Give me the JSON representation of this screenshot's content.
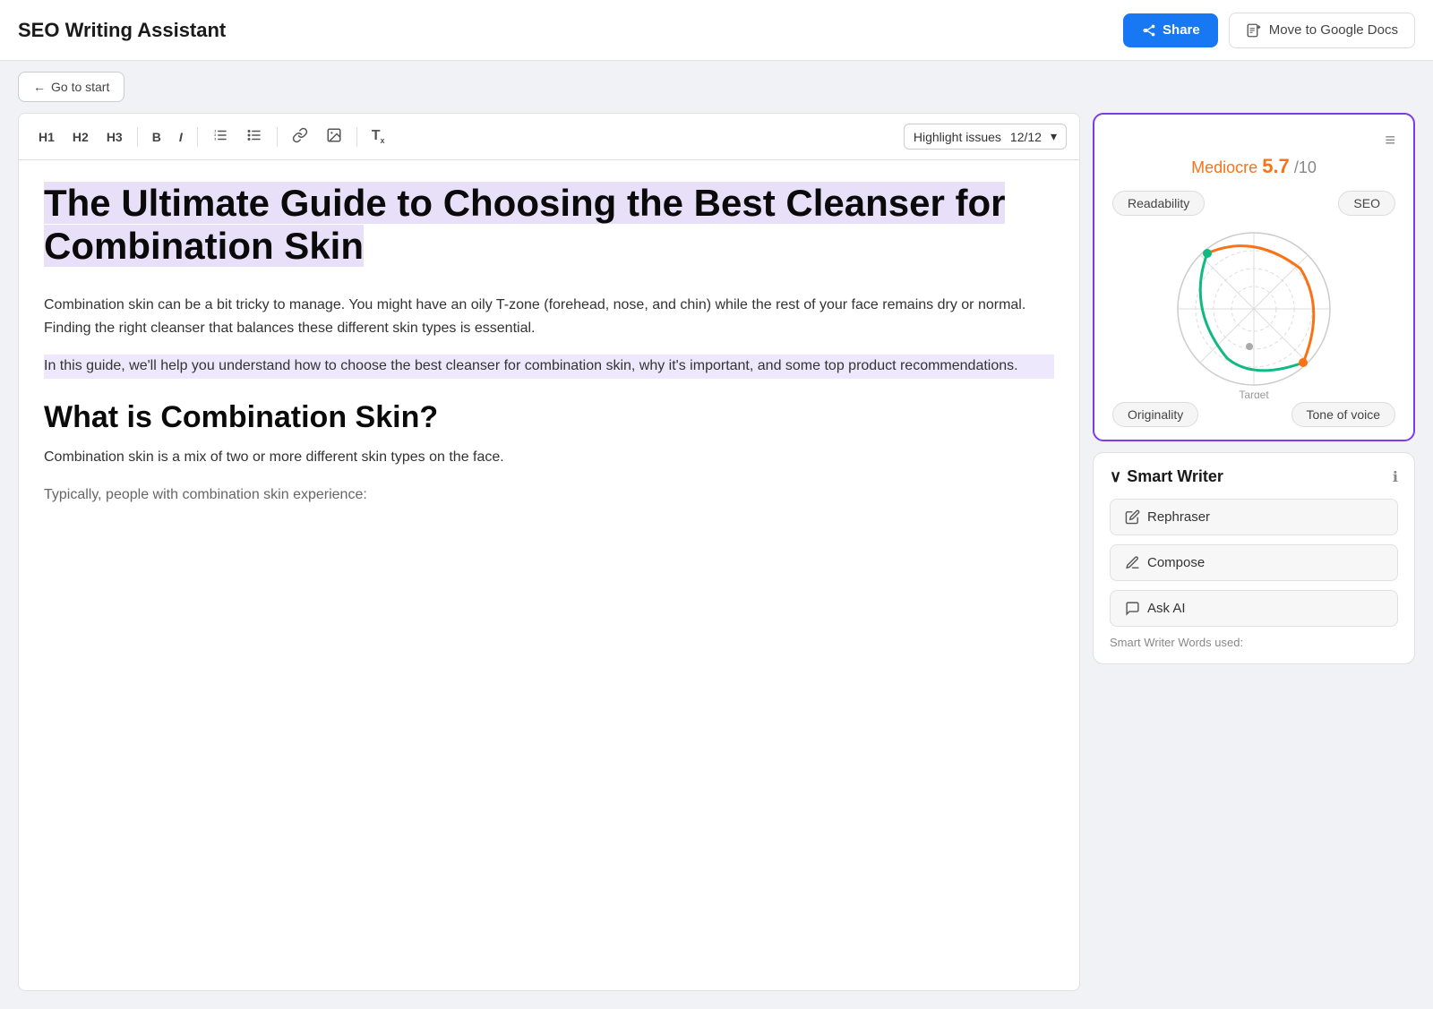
{
  "header": {
    "title": "SEO Writing Assistant",
    "share_label": "Share",
    "move_label": "Move to Google Docs"
  },
  "sub_header": {
    "go_start_label": "Go to start"
  },
  "toolbar": {
    "h1": "H1",
    "h2": "H2",
    "h3": "H3",
    "bold": "B",
    "italic": "I",
    "highlight_label": "Highlight issues",
    "highlight_count": "12/12"
  },
  "article": {
    "title": "The Ultimate Guide to Choosing the Best Cleanser for Combination Skin",
    "para1": "Combination skin can be a bit tricky to manage. You might have an oily T-zone (forehead, nose, and chin) while the rest of your face remains dry or normal. Finding the right cleanser that balances these different skin types is essential.",
    "para2": "In this guide, we'll help you understand how to choose the best cleanser for combination skin, why it's important, and some top product recommendations.",
    "h2": "What is Combination Skin?",
    "para3": "Combination skin is a mix of two or more different skin types on the face.",
    "para4": "Typically, people with combination skin experience:"
  },
  "score_card": {
    "quality_label": "Mediocre",
    "score": "5.7",
    "denom": "/10",
    "readability_label": "Readability",
    "seo_label": "SEO",
    "originality_label": "Originality",
    "tone_label": "Tone of voice",
    "target_label": "Target"
  },
  "smart_writer": {
    "section_title": "Smart Writer",
    "rephraser_label": "Rephraser",
    "compose_label": "Compose",
    "ask_ai_label": "Ask AI",
    "words_used_label": "Smart Writer Words used:"
  },
  "colors": {
    "purple_accent": "#7c3aed",
    "orange_score": "#f97316",
    "green_radar": "#10b981",
    "orange_radar": "#f97316",
    "share_blue": "#1877f2"
  }
}
